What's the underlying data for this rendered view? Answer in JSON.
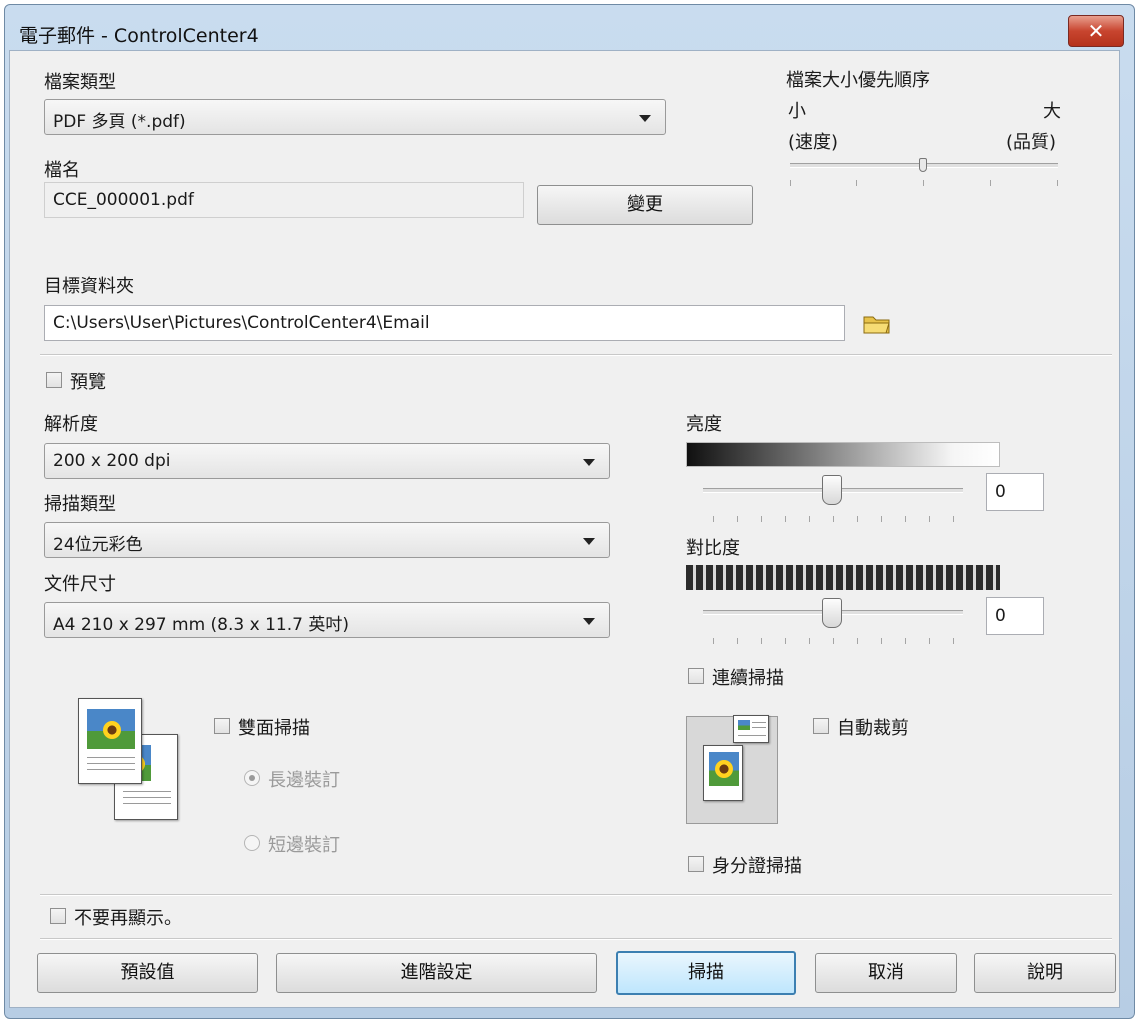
{
  "window": {
    "title": "電子郵件 - ControlCenter4",
    "close_glyph": "✕"
  },
  "file_type": {
    "label": "檔案類型",
    "value": "PDF 多頁 (*.pdf)"
  },
  "file_size_priority": {
    "label": "檔案大小優先順序",
    "small": "小",
    "large": "大",
    "speed": "(速度)",
    "quality": "(品質)"
  },
  "file_name": {
    "label": "檔名",
    "value": "CCE_000001.pdf",
    "change_button": "變更"
  },
  "destination": {
    "label": "目標資料夾",
    "value": "C:\\Users\\User\\Pictures\\ControlCenter4\\Email",
    "browse_icon": "folder-icon"
  },
  "preview": {
    "label": "預覽"
  },
  "resolution": {
    "label": "解析度",
    "value": "200 x 200 dpi"
  },
  "scan_type": {
    "label": "掃描類型",
    "value": "24位元彩色"
  },
  "document_size": {
    "label": "文件尺寸",
    "value": "A4 210 x 297 mm (8.3 x 11.7 英吋)"
  },
  "brightness": {
    "label": "亮度",
    "value": "0"
  },
  "contrast": {
    "label": "對比度",
    "value": "0"
  },
  "continuous_scan": {
    "label": "連續掃描"
  },
  "duplex": {
    "label": "雙面掃描",
    "long_edge": "長邊裝訂",
    "short_edge": "短邊裝訂"
  },
  "auto_crop": {
    "label": "自動裁剪"
  },
  "id_card_scan": {
    "label": "身分證掃描"
  },
  "dont_show_again": {
    "label": "不要再顯示。"
  },
  "buttons": {
    "default": "預設值",
    "advanced": "進階設定",
    "scan": "掃描",
    "cancel": "取消",
    "help": "說明"
  }
}
